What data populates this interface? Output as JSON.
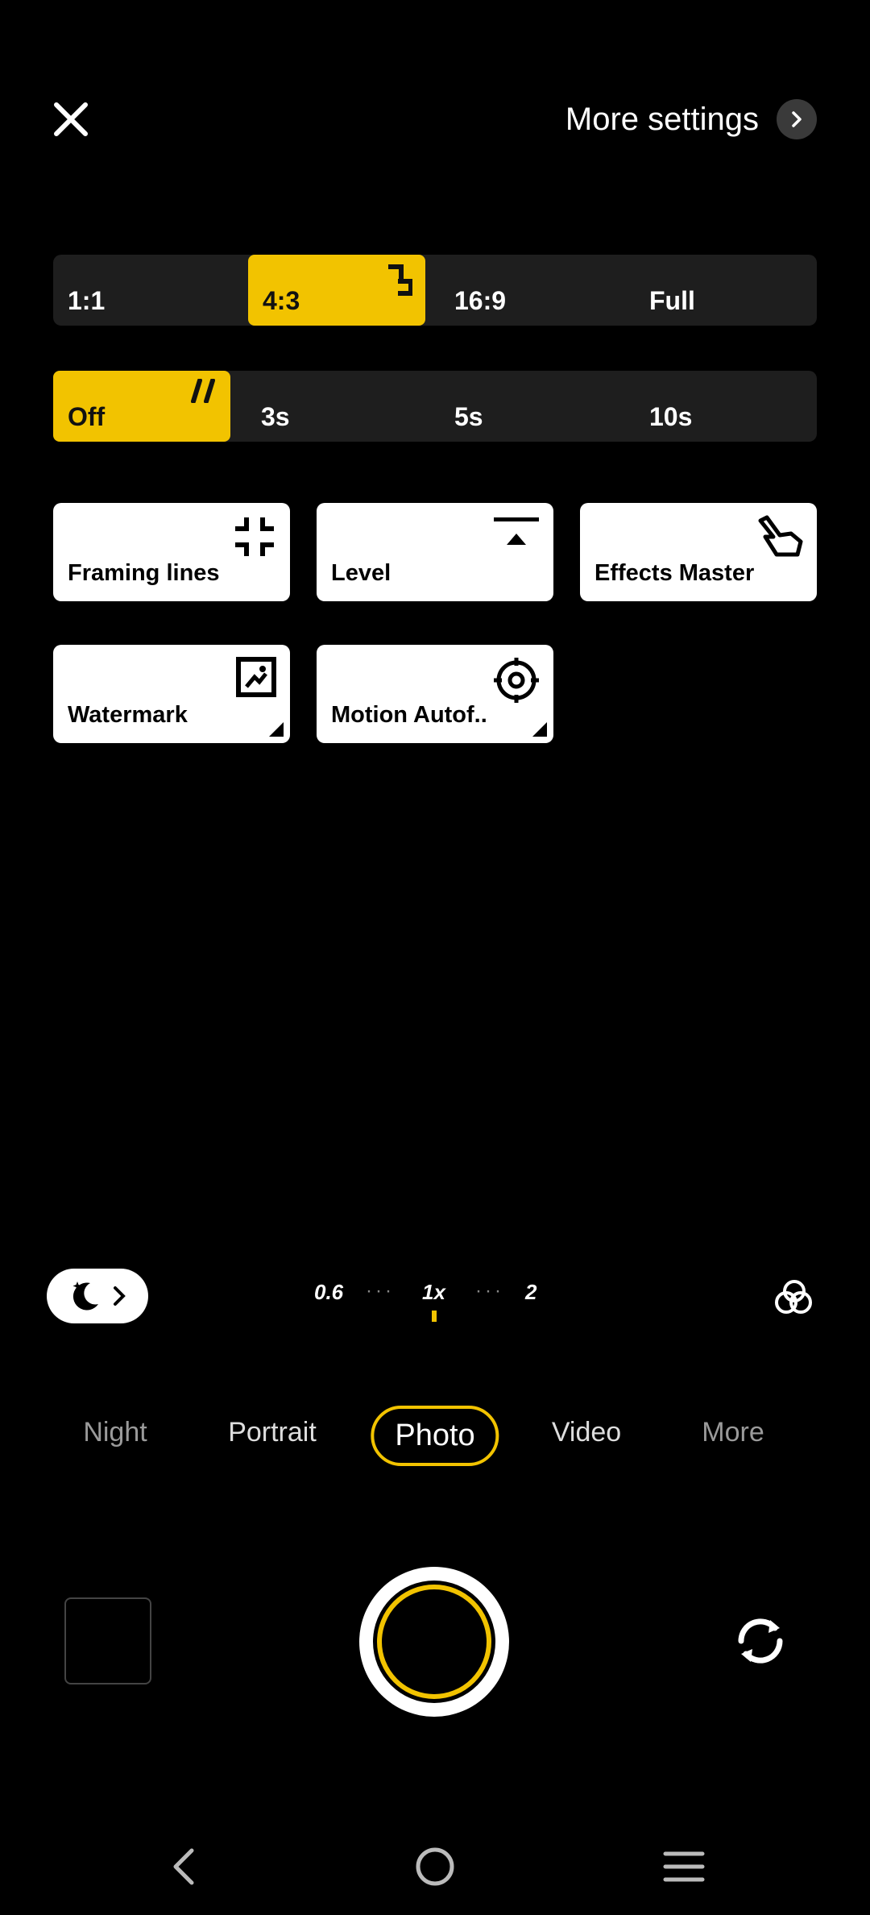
{
  "top_bar": {
    "more_settings_label": "More settings"
  },
  "aspect_ratio": {
    "options": [
      "1:1",
      "4:3",
      "16:9",
      "Full"
    ],
    "selected": "4:3"
  },
  "timer": {
    "options": [
      "Off",
      "3s",
      "5s",
      "10s"
    ],
    "selected": "Off"
  },
  "tiles": {
    "framing_lines": "Framing lines",
    "level": "Level",
    "effects_master": "Effects Master",
    "watermark": "Watermark",
    "motion_autofocus": "Motion Autof.."
  },
  "zoom": {
    "levels": [
      "0.6",
      "1x",
      "2"
    ],
    "selected": "1x"
  },
  "modes": {
    "items": [
      "Night",
      "Portrait",
      "Photo",
      "Video",
      "More"
    ],
    "selected": "Photo"
  },
  "colors": {
    "accent": "#f2c300",
    "background": "#000000",
    "tile": "#ffffff"
  }
}
